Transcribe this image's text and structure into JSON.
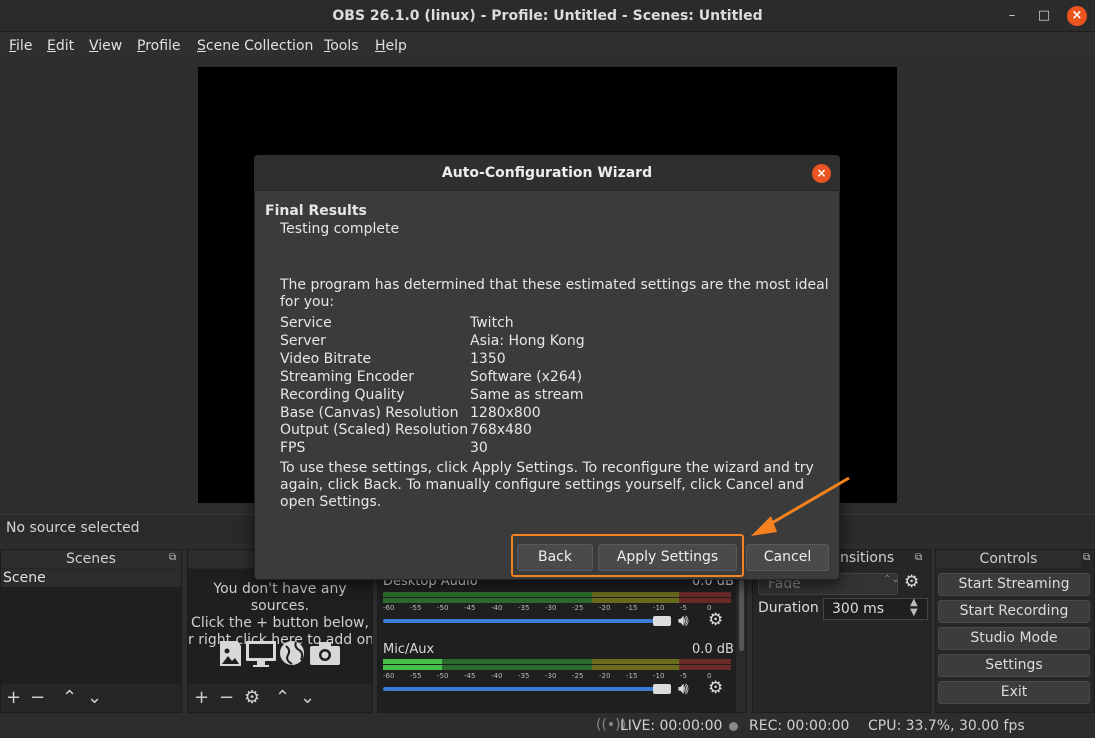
{
  "window": {
    "title": "OBS 26.1.0 (linux) - Profile: Untitled - Scenes: Untitled",
    "minimize_icon": "minimize-icon",
    "maximize_icon": "maximize-icon",
    "close_icon": "close-icon",
    "minimize_glyph": "–",
    "maximize_glyph": "□",
    "close_glyph": "×"
  },
  "menu": [
    "File",
    "Edit",
    "View",
    "Profile",
    "Scene Collection",
    "Tools",
    "Help"
  ],
  "source_bar": {
    "text": "No source selected"
  },
  "scenes_dock": {
    "title": "Scenes",
    "items": [
      "Scene"
    ],
    "toolbar": [
      "+",
      "−",
      "⌃",
      "⌄"
    ]
  },
  "sources_dock": {
    "title": "S",
    "empty_lines": [
      "You don't have any sources.",
      "Click the + button below,",
      "r right click here to add one"
    ],
    "toolbar": [
      "+",
      "−",
      "⚙",
      "⌃",
      "⌄"
    ]
  },
  "mixer": {
    "channels": [
      {
        "name": "Desktop Audio",
        "db": "0.0 dB",
        "level": 0.0
      },
      {
        "name": "Mic/Aux",
        "db": "0.0 dB",
        "level": 0.17
      }
    ],
    "ticks": [
      "-60",
      "-55",
      "-50",
      "-45",
      "-40",
      "-35",
      "-30",
      "-25",
      "-20",
      "-15",
      "-10",
      "-5",
      "0"
    ]
  },
  "transitions_dock": {
    "title": "nsitions",
    "transition": "Fade",
    "duration_label": "Duration",
    "duration_value": "300 ms"
  },
  "controls_dock": {
    "title": "Controls",
    "buttons": [
      "Start Streaming",
      "Start Recording",
      "Studio Mode",
      "Settings",
      "Exit"
    ]
  },
  "statusbar": {
    "live": "LIVE: 00:00:00",
    "rec": "REC: 00:00:00",
    "cpu": "CPU: 33.7%, 30.00 fps"
  },
  "dialog": {
    "title": "Auto-Configuration Wizard",
    "heading": "Final Results",
    "subheading": "Testing complete",
    "intro_line1": "The program has determined that these estimated settings are the most ideal",
    "intro_line2": "for you:",
    "rows": [
      {
        "label": "Service",
        "value": "Twitch"
      },
      {
        "label": "Server",
        "value": "Asia: Hong Kong"
      },
      {
        "label": "Video Bitrate",
        "value": "1350"
      },
      {
        "label": "Streaming Encoder",
        "value": "Software (x264)"
      },
      {
        "label": "Recording Quality",
        "value": "Same as stream"
      },
      {
        "label": "Base (Canvas) Resolution",
        "value": "1280x800"
      },
      {
        "label": "Output (Scaled) Resolution",
        "value": "768x480"
      },
      {
        "label": "FPS",
        "value": "30"
      }
    ],
    "outro_line1": "To use these settings, click Apply Settings. To reconfigure the wizard and try",
    "outro_line2": "again, click Back. To manually configure settings yourself, click Cancel and",
    "outro_line3": "open Settings.",
    "back_label": "Back",
    "apply_label": "Apply Settings",
    "cancel_label": "Cancel"
  },
  "colors": {
    "accent": "#e95420",
    "highlight": "#f5821f",
    "slider": "#3a7bd5"
  }
}
